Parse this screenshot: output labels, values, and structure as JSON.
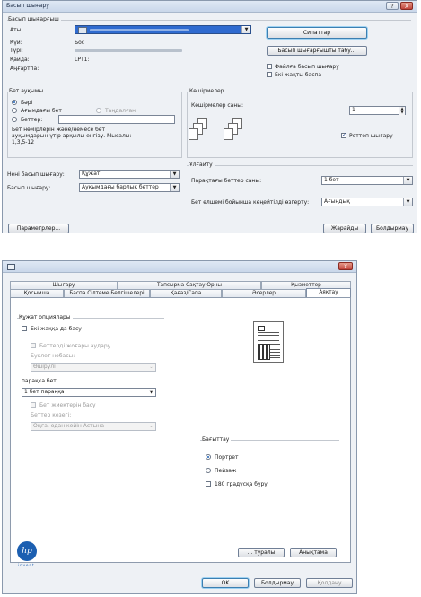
{
  "dialog1": {
    "title": "Басып шығару",
    "help_btn": "?",
    "close_btn": "X",
    "printer_group": "Басып шығарғыш",
    "name_label": "Аты:",
    "status_label": "Күй:",
    "status_value": "Бос",
    "type_label": "Түрі:",
    "where_label": "Қайда:",
    "where_value": "LPT1:",
    "comment_label": "Аңғартпа:",
    "properties_btn": "Сипаттар",
    "find_printer_btn": "Басып шығарғышты табу...",
    "print_to_file": "Файлға басып шығару",
    "manual_duplex": "Екі жақты баспа",
    "range_group": "Бет ауқымы",
    "range_all": "Бәрі",
    "range_current": "Ағымдағы бет",
    "range_selection": "Таңдалған",
    "range_pages": "Беттер:",
    "range_hint": "Бет нөмірлерін және/немесе бет ауқымдарын үтір арқылы енгізу. Мысалы: 1,3,5-12",
    "copies_group": "Көшірмелер",
    "copies_label": "Көшірмелер саны:",
    "copies_value": "1",
    "collate": "Реттеп шығару",
    "print_what_label": "Нені басып шығару:",
    "print_what_value": "Құжат",
    "print_label": "Басып шығару:",
    "print_value": "Ауқымдағы барлық беттер",
    "zoom_group": "Ұлғайту",
    "pages_per_sheet_label": "Парақтағы беттер саны:",
    "pages_per_sheet_value": "1 бет",
    "scale_label": "Бет өлшемі бойынша кеңейтілді өзгерту:",
    "scale_value": "Ағындық",
    "options_btn": "Параметрлер...",
    "ok_btn": "Жарайды",
    "cancel_btn": "Болдырмау"
  },
  "dialog2": {
    "title_icon": "printer-icon",
    "close_btn": "X",
    "tabs_row1": [
      "Шығару",
      "Тапсырма Сақтау Орны",
      "Қызметтер"
    ],
    "tabs_row2": [
      "Қосымша",
      "Баспа Сілтеме Белгішелері",
      "Қағаз/Сапа",
      "Әсерлер",
      "Аяқтау"
    ],
    "doc_options_group": "Құжат опциялары",
    "print_both_sides": "Екі жаққа да басу",
    "flip_pages_up": "Беттерді жоғары аудару",
    "booklet_layout_label": "Буклет нобасы:",
    "booklet_layout_value": "Өшірулі",
    "pages_per_sheet_label": "парақка бет",
    "pages_per_sheet_value": "1 бет параққа",
    "print_page_borders": "Бет жиектерін басу",
    "page_order_label": "Беттер кезегі:",
    "page_order_value": "Оңға, одан кейін Астына",
    "orientation_group": "Бағыттау",
    "portrait": "Портрет",
    "landscape": "Пейзаж",
    "rotate_180": "180 градусқа бұру",
    "hp_logo": "hp",
    "hp_tagline": "invent",
    "about_btn": "... туралы",
    "help_btn": "Анықтама",
    "ok_btn": "OK",
    "cancel_btn": "Болдырмау",
    "apply_btn": "Қолдану"
  },
  "colors": {
    "accent": "#3c7fb1",
    "title_bar": "#c9d7ea",
    "dialog_bg": "#eef1f5"
  }
}
